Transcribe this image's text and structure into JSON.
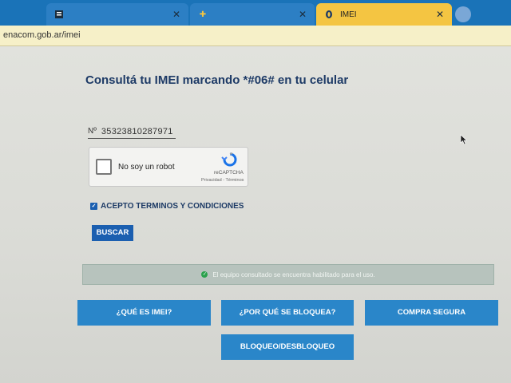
{
  "browser": {
    "tabs": [
      {
        "title": "",
        "active": false,
        "favicon": "document-icon"
      },
      {
        "title": "",
        "active": false,
        "favicon": "crest-icon"
      },
      {
        "title": "IMEI",
        "active": true,
        "favicon": "enacom-icon"
      }
    ],
    "url": "enacom.gob.ar/imei"
  },
  "page": {
    "heading": "Consultá tu IMEI marcando *#06# en tu celular",
    "imei_prefix": "Nº",
    "imei_value": "35323810287971",
    "captcha": {
      "label": "No soy un robot",
      "brand": "reCAPTCHA",
      "links": "Privacidad - Términos"
    },
    "terms_label": "ACEPTO TERMINOS Y CONDICIONES",
    "search_label": "BUSCAR",
    "status_message": "El equipo consultado se encuentra habilitado para el uso.",
    "nav": {
      "what_is_imei": "¿QUÉ ES IMEI?",
      "why_blocked": "¿POR QUÉ SE BLOQUEA?",
      "safe_purchase": "COMPRA SEGURA",
      "block_unblock": "BLOQUEO/DESBLOQUEO"
    }
  },
  "colors": {
    "tab_strip": "#1a73b8",
    "active_tab": "#f4c542",
    "heading": "#1d3a66",
    "primary_button": "#1b5fb0",
    "nav_button": "#2a86c9",
    "status_bg": "#b7c3bd",
    "status_ok": "#2aa14c"
  }
}
